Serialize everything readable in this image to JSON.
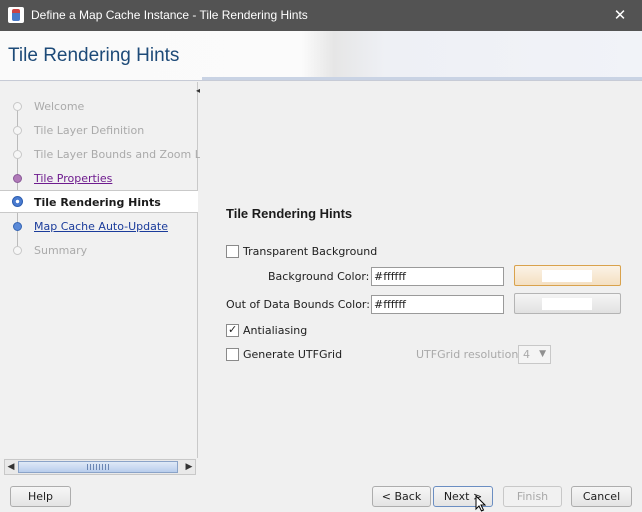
{
  "window": {
    "title": "Define a Map Cache Instance - Tile Rendering Hints",
    "close_glyph": "✕"
  },
  "header": {
    "title": "Tile Rendering Hints"
  },
  "nav": {
    "items": [
      {
        "label": "Welcome",
        "state": "disabled"
      },
      {
        "label": "Tile Layer Definition",
        "state": "disabled"
      },
      {
        "label": "Tile Layer Bounds and Zoom Levels",
        "state": "disabled"
      },
      {
        "label": "Tile Properties",
        "state": "visited"
      },
      {
        "label": "Tile Rendering Hints",
        "state": "active"
      },
      {
        "label": "Map Cache Auto-Update",
        "state": "link"
      },
      {
        "label": "Summary",
        "state": "disabled"
      }
    ],
    "scroll_left": "◀",
    "scroll_right": "▶"
  },
  "panel": {
    "title": "Tile Rendering Hints",
    "transparent_background": {
      "label": "Transparent Background",
      "checked": false
    },
    "background_color": {
      "label": "Background Color:",
      "value": "#ffffff",
      "swatch": "#ffffff"
    },
    "out_of_bounds_color": {
      "label": "Out of Data Bounds Color:",
      "value": "#ffffff",
      "swatch": "#ffffff"
    },
    "antialiasing": {
      "label": "Antialiasing",
      "checked": true
    },
    "generate_utfgrid": {
      "label": "Generate UTFGrid",
      "checked": false
    },
    "utfgrid_resolution": {
      "label": "UTFGrid resolution:",
      "value": "4",
      "arrow": "▼"
    }
  },
  "footer": {
    "help": "Help",
    "back": "< Back",
    "next": "Next >",
    "finish": "Finish",
    "cancel": "Cancel"
  },
  "colors": {
    "accent": "#1d4a78",
    "link": "#1b3c9b",
    "visited": "#6e1b8e",
    "focus": "#d9a24c"
  }
}
